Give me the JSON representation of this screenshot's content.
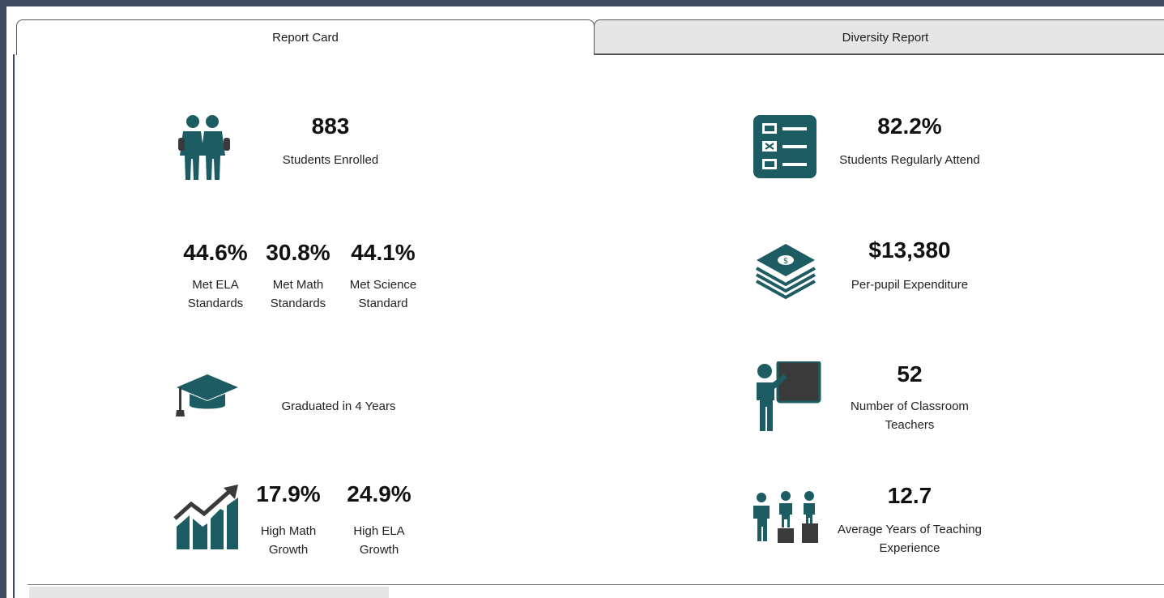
{
  "tabs": [
    {
      "label": "Report Card",
      "active": true
    },
    {
      "label": "Diversity Report",
      "active": false
    }
  ],
  "colors": {
    "accent": "#1d5c62",
    "dark": "#3a3a3a"
  },
  "left": {
    "enrolled": {
      "value": "883",
      "label": "Students Enrolled",
      "icon": "students-icon"
    },
    "standards": [
      {
        "value": "44.6%",
        "label_line1": "Met ELA",
        "label_line2": "Standards"
      },
      {
        "value": "30.8%",
        "label_line1": "Met Math",
        "label_line2": "Standards"
      },
      {
        "value": "44.1%",
        "label_line1": "Met Science",
        "label_line2": "Standard"
      }
    ],
    "graduated": {
      "label": "Graduated in 4 Years",
      "icon": "graduation-cap-icon"
    },
    "growth": {
      "icon": "growth-chart-icon",
      "items": [
        {
          "value": "17.9%",
          "label_line1": "High Math",
          "label_line2": "Growth"
        },
        {
          "value": "24.9%",
          "label_line1": "High ELA",
          "label_line2": "Growth"
        }
      ]
    }
  },
  "right": {
    "attendance": {
      "value": "82.2%",
      "label": "Students Regularly Attend",
      "icon": "checklist-icon"
    },
    "expenditure": {
      "value": "$13,380",
      "label": "Per-pupil Expenditure",
      "icon": "money-stack-icon"
    },
    "teachers": {
      "value": "52",
      "label_line1": "Number of Classroom",
      "label_line2": "Teachers",
      "icon": "teacher-board-icon"
    },
    "experience": {
      "value": "12.7",
      "label_line1": "Average Years of Teaching",
      "label_line2": "Experience",
      "icon": "podium-people-icon"
    }
  }
}
